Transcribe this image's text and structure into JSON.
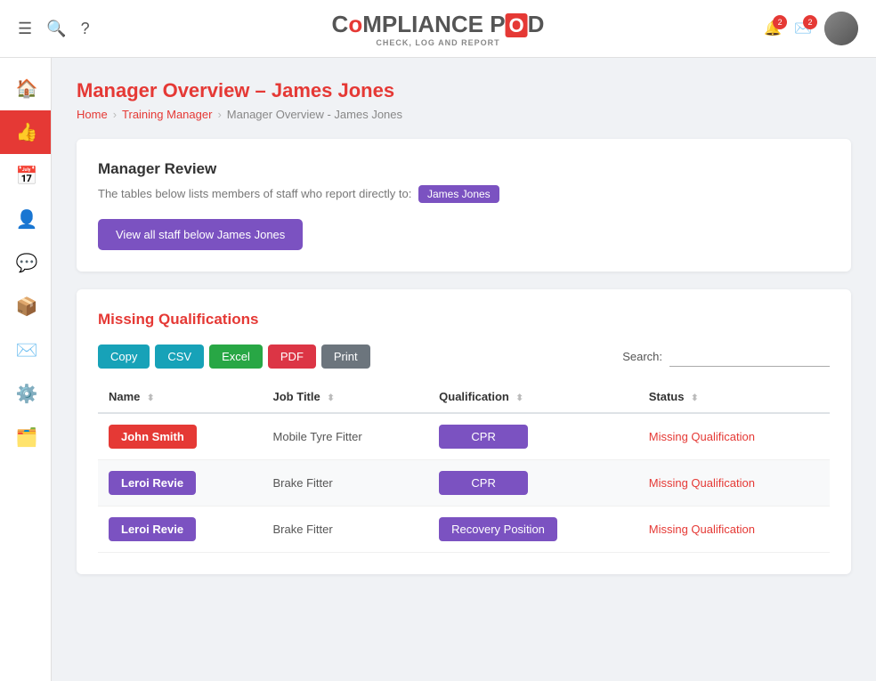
{
  "app": {
    "title": "Compliance Pod",
    "subtitle": "CHECK, LOG AND REPORT"
  },
  "topnav": {
    "hamburger_label": "☰",
    "search_label": "🔍",
    "help_label": "?",
    "notifications_count": "2",
    "messages_count": "2"
  },
  "sidebar": {
    "items": [
      {
        "id": "home",
        "icon": "🏠",
        "active": false
      },
      {
        "id": "thumbsup",
        "icon": "👍",
        "active": true
      },
      {
        "id": "calendar",
        "icon": "📅",
        "active": false
      },
      {
        "id": "people",
        "icon": "👤",
        "active": false
      },
      {
        "id": "chat",
        "icon": "💬",
        "active": false
      },
      {
        "id": "box",
        "icon": "📦",
        "active": false
      },
      {
        "id": "mail",
        "icon": "✉️",
        "active": false
      },
      {
        "id": "settings",
        "icon": "⚙️",
        "active": false
      },
      {
        "id": "layers",
        "icon": "🗂️",
        "active": false
      }
    ]
  },
  "breadcrumb": {
    "home": "Home",
    "section": "Training Manager",
    "current": "Manager Overview - James Jones"
  },
  "page_title": "Manager Overview – James Jones",
  "manager_review": {
    "title": "Manager Review",
    "description_before": "The tables below lists members of staff who report directly to:",
    "manager_name": "James Jones",
    "button_label": "View all staff below James Jones"
  },
  "missing_qualifications": {
    "section_title": "Missing Qualifications",
    "buttons": {
      "copy": "Copy",
      "csv": "CSV",
      "excel": "Excel",
      "pdf": "PDF",
      "print": "Print"
    },
    "search_label": "Search:",
    "columns": [
      "Name",
      "Job Title",
      "Qualification",
      "Status"
    ],
    "rows": [
      {
        "name": "John Smith",
        "name_style": "red",
        "job_title": "Mobile Tyre Fitter",
        "qualification": "CPR",
        "status": "Missing Qualification"
      },
      {
        "name": "Leroi Revie",
        "name_style": "purple",
        "job_title": "Brake Fitter",
        "qualification": "CPR",
        "status": "Missing Qualification"
      },
      {
        "name": "Leroi Revie",
        "name_style": "purple",
        "job_title": "Brake Fitter",
        "qualification": "Recovery Position",
        "status": "Missing Qualification"
      }
    ]
  }
}
